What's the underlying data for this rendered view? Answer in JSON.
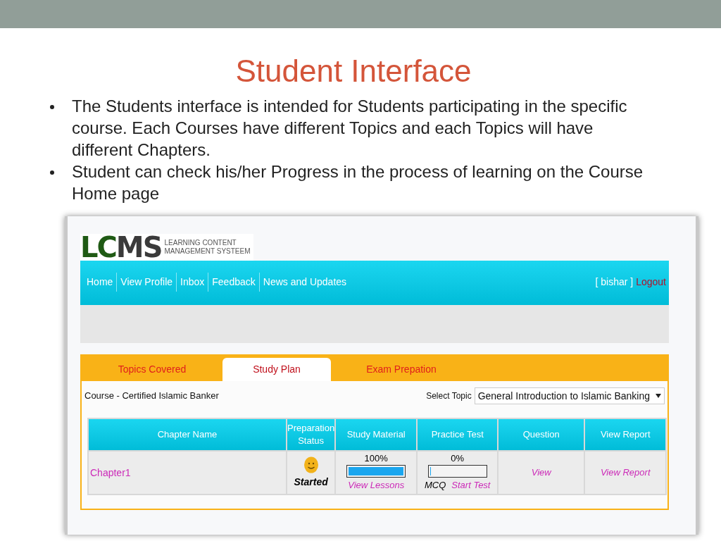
{
  "slide": {
    "title": "Student Interface",
    "bullets": [
      "The Students interface is intended for Students participating in the specific course. Each Courses have different Topics and each Topics will have different Chapters.",
      "Student can check his/her Progress in the process of learning on the Course Home page"
    ]
  },
  "app": {
    "logo": {
      "mark": "LCMS",
      "tagline_1": "LEARNING CONTENT",
      "tagline_2": "MANAGEMENT SYSTEEM"
    },
    "nav": [
      {
        "label": "Home"
      },
      {
        "label": "View Profile"
      },
      {
        "label": "Inbox"
      },
      {
        "label": "Feedback"
      },
      {
        "label": "News and Updates"
      }
    ],
    "user": "[ bishar ]",
    "logout": "Logout",
    "tabs": [
      {
        "label": "Topics Covered",
        "selected": false
      },
      {
        "label": "Study Plan",
        "selected": true
      },
      {
        "label": "Exam Prepation",
        "selected": false
      }
    ],
    "course": "Course - Certified Islamic Banker",
    "topic_label": "Select Topic",
    "topic_value": "General Introduction to Islamic Banking",
    "table": {
      "columns": [
        "Chapter Name",
        "Preparation Status",
        "Study Material",
        "Practice Test",
        "Question",
        "View Report"
      ],
      "rows": [
        {
          "chapter": "Chapter1",
          "status": "Started",
          "study_material": {
            "reading": "100%",
            "level": 1,
            "link": "View Lessons"
          },
          "practice_test": {
            "reading": "0%",
            "level": 0,
            "type": "MCQ",
            "link": "Start Test"
          },
          "question": "View",
          "report": "View Report"
        }
      ]
    }
  }
}
